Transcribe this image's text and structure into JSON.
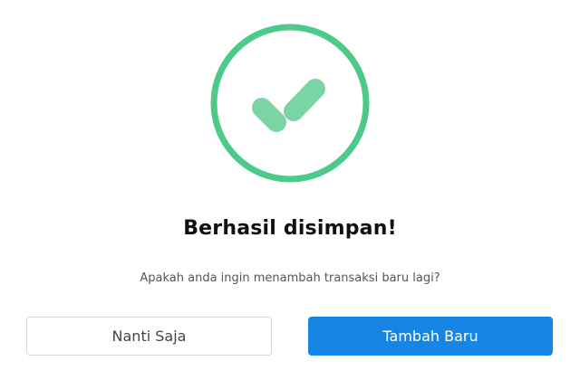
{
  "dialog": {
    "icon": "check-circle-icon",
    "title": "Berhasil disimpan!",
    "message": "Apakah anda ingin menambah transaksi baru lagi?",
    "buttons": {
      "later_label": "Nanti Saja",
      "add_new_label": "Tambah Baru"
    }
  },
  "colors": {
    "success_ring": "#4dc98a",
    "success_check": "#7ad4a3",
    "primary": "#1685e4",
    "secondary_border": "#d6d6d6"
  }
}
